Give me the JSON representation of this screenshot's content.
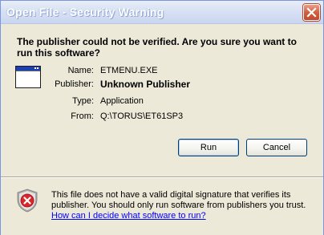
{
  "window": {
    "title": "Open File - Security Warning"
  },
  "dialog": {
    "headline": "The publisher could not be verified.  Are you sure you want to run this software?",
    "fields": [
      {
        "label": "Name:",
        "value": "ETMENU.EXE"
      },
      {
        "label": "Publisher:",
        "value": "Unknown Publisher"
      },
      {
        "label": "Type:",
        "value": "Application"
      },
      {
        "label": "From:",
        "value": "Q:\\TORUS\\ET61SP3"
      }
    ],
    "buttons": {
      "run": "Run",
      "cancel": "Cancel"
    }
  },
  "footer": {
    "warning": "This file does not have a valid digital signature that verifies its publisher.  You should only run software from publishers you trust.",
    "help_link": "How can I decide what software to run?"
  },
  "colors": {
    "title_bar": "#d8e1f4",
    "dialog_bg": "#ece9d8",
    "close_button": "#d15f3f",
    "link": "#0000ff",
    "shield": "#d8262b"
  },
  "icons": {
    "close": "close-icon",
    "app": "application-window-icon",
    "shield": "shield-warning-icon"
  }
}
